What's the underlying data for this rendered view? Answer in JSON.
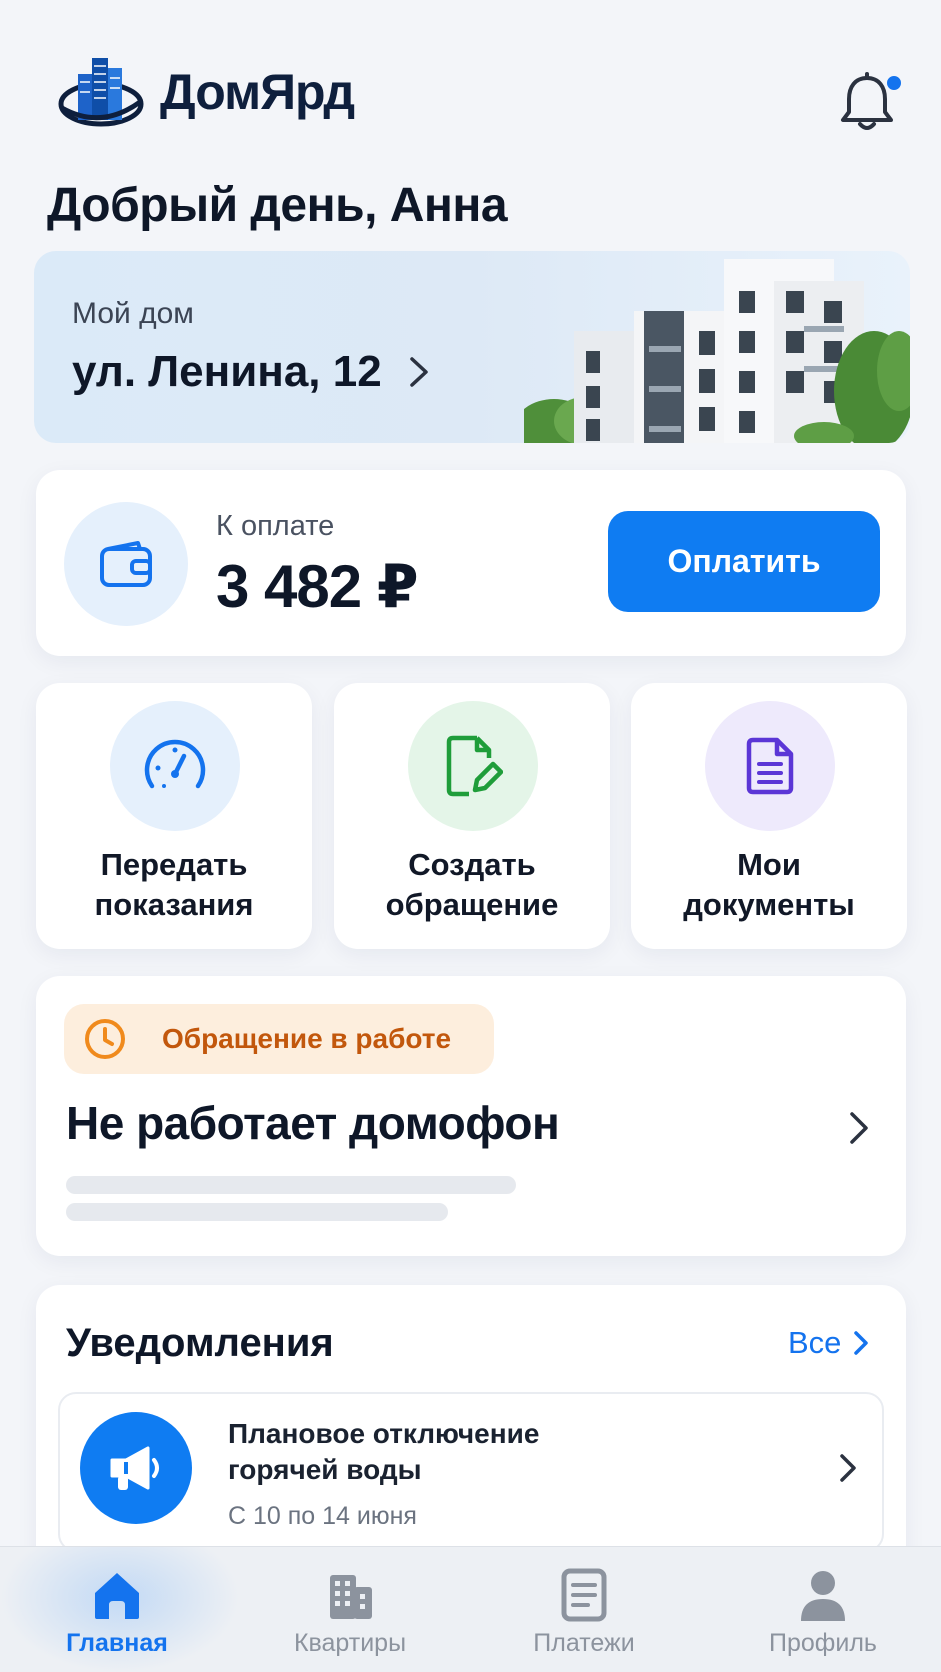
{
  "app": {
    "name": "ДомЯрд",
    "accent_color": "#0f7cf2",
    "notification_dot": true
  },
  "greeting": "Добрый день, Анна",
  "home": {
    "label": "Мой дом",
    "address": "ул. Ленина, 12"
  },
  "payment": {
    "label": "К оплате",
    "amount": "3 482 ₽",
    "button": "Оплатить",
    "icon": "wallet-icon"
  },
  "actions": [
    {
      "label": "Передать\nпоказания",
      "icon": "meter-gauge-icon",
      "bg": "#e5f0fc",
      "color": "#1473ee"
    },
    {
      "label": "Создать\nобращение",
      "icon": "document-edit-icon",
      "bg": "#e4f5e8",
      "color": "#1f9d3a"
    },
    {
      "label": "Мои\nдокументы",
      "icon": "document-icon",
      "bg": "#eeeafc",
      "color": "#5b36d6"
    }
  ],
  "ticket": {
    "status": "Обращение в работе",
    "status_color": "#c2570c",
    "title": "Не работает домофон"
  },
  "notifications": {
    "title": "Уведомления",
    "all_link": "Все",
    "items": [
      {
        "title": "Плановое отключение\nгорячей воды",
        "date": "С 10 по 14 июня",
        "icon": "megaphone-icon"
      }
    ]
  },
  "tabs": [
    {
      "label": "Главная",
      "icon": "home-icon",
      "active": true
    },
    {
      "label": "Квартиры",
      "icon": "building-icon",
      "active": false
    },
    {
      "label": "Платежи",
      "icon": "receipt-icon",
      "active": false
    },
    {
      "label": "Профиль",
      "icon": "profile-icon",
      "active": false
    }
  ]
}
